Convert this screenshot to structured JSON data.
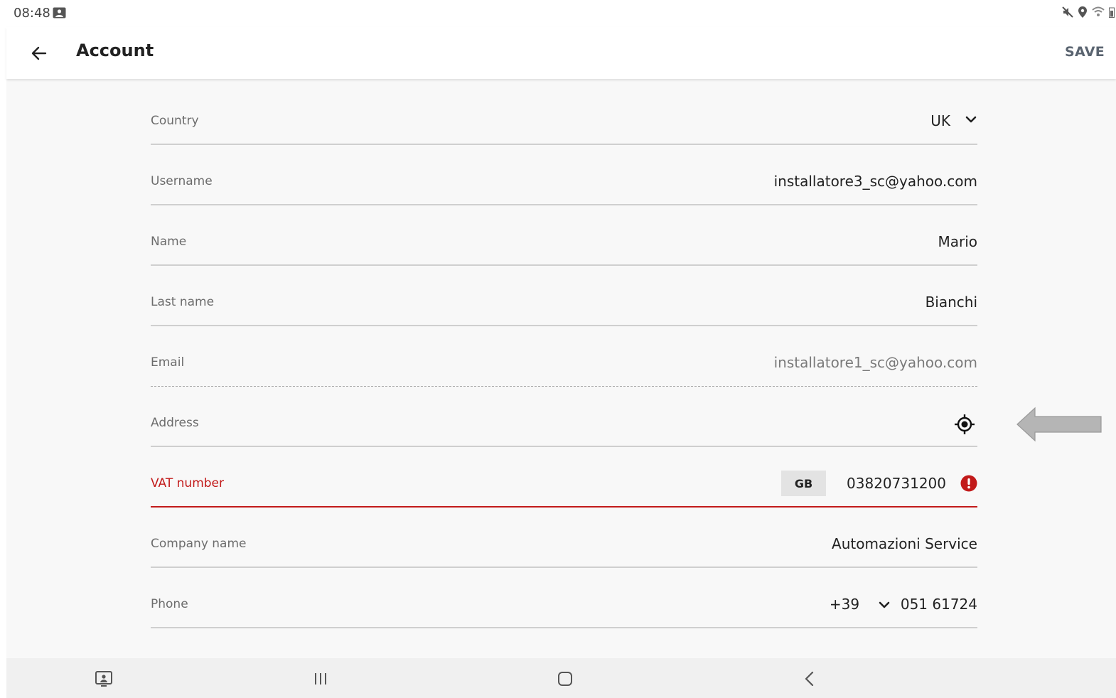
{
  "status_bar": {
    "time": "08:48"
  },
  "app_bar": {
    "title": "Account",
    "save_label": "SAVE"
  },
  "form": {
    "country": {
      "label": "Country",
      "value": "UK"
    },
    "username": {
      "label": "Username",
      "value": "installatore3_sc@yahoo.com"
    },
    "name": {
      "label": "Name",
      "value": "Mario"
    },
    "last_name": {
      "label": "Last name",
      "value": "Bianchi"
    },
    "email": {
      "label": "Email",
      "value": "installatore1_sc@yahoo.com"
    },
    "address": {
      "label": "Address",
      "value": ""
    },
    "vat": {
      "label": "VAT number",
      "country_code": "GB",
      "value": "03820731200"
    },
    "company": {
      "label": "Company name",
      "value": "Automazioni Service"
    },
    "phone": {
      "label": "Phone",
      "prefix": "+39",
      "value": "051 61724"
    }
  },
  "colors": {
    "error": "#c21a1a",
    "divider": "#cfcfcf",
    "background": "#f8f8f8"
  }
}
